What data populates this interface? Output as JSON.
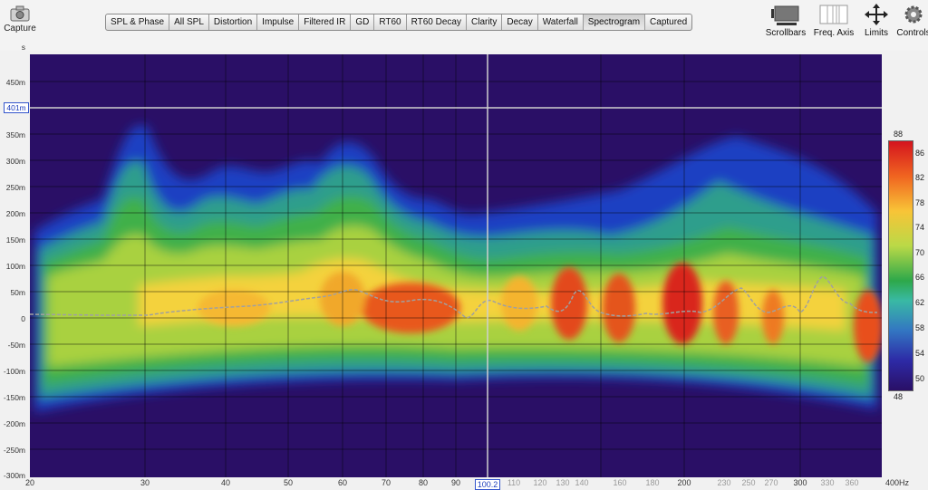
{
  "toolbar": {
    "capture_label": "Capture",
    "tabs": [
      "SPL & Phase",
      "All SPL",
      "Distortion",
      "Impulse",
      "Filtered IR",
      "GD",
      "RT60",
      "RT60 Decay",
      "Clarity",
      "Decay",
      "Waterfall",
      "Spectrogram",
      "Captured"
    ],
    "active_tab": "Spectrogram",
    "right_tools": [
      "Scrollbars",
      "Freq. Axis",
      "Limits",
      "Controls"
    ]
  },
  "plot": {
    "y_unit": "s",
    "y_labels": [
      "450m",
      "350m",
      "300m",
      "250m",
      "200m",
      "150m",
      "100m",
      "50m",
      "0",
      "-50m",
      "-100m",
      "-150m",
      "-200m",
      "-250m",
      "-300m"
    ],
    "cursor_y": "401m",
    "x_labels": [
      "20",
      "30",
      "40",
      "50",
      "60",
      "70",
      "80",
      "90",
      "110",
      "120",
      "130",
      "140",
      "160",
      "180",
      "200",
      "230",
      "250",
      "270",
      "300",
      "330",
      "360",
      "400Hz"
    ],
    "cursor_x": "100.2",
    "colorbar": {
      "top": "88",
      "bottom": "48",
      "labels": [
        "86",
        "82",
        "78",
        "74",
        "70",
        "66",
        "62",
        "58",
        "54",
        "50"
      ]
    }
  },
  "colors": {
    "background": "#2a0f66",
    "grid": "#ffffff"
  }
}
